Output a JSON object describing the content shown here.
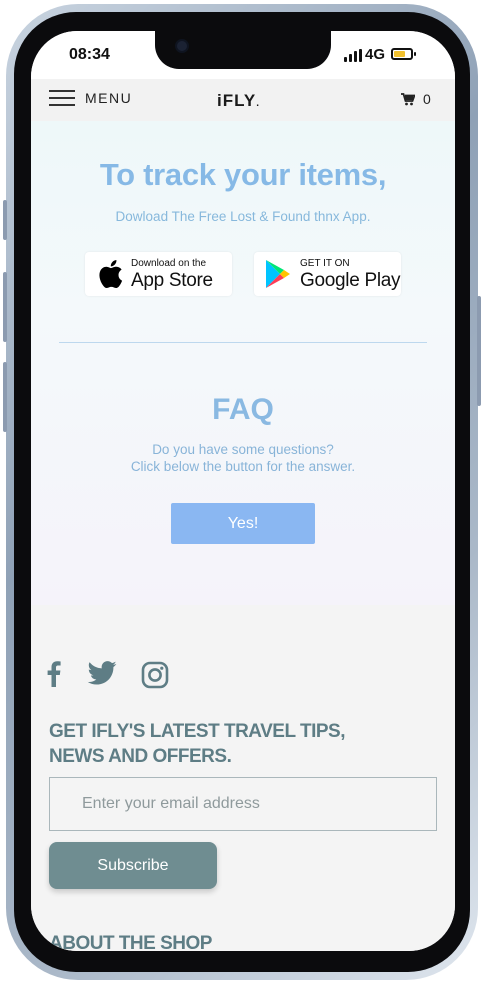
{
  "status_bar": {
    "time": "08:34",
    "network": "4G",
    "battery_color": "#f2c12e"
  },
  "nav": {
    "menu_label": "MENU",
    "logo": "iFLY",
    "cart_count": "0",
    "menu_icon": "hamburger-icon",
    "cart_icon": "cart-icon"
  },
  "promo": {
    "headline": "To track your items,",
    "subtitle": "Dowload The Free Lost & Found thnx App.",
    "app_store": {
      "small": "Download on the",
      "big": "App Store",
      "icon": "apple-icon"
    },
    "google_play": {
      "small": "GET IT ON",
      "big": "Google Play",
      "icon": "google-play-icon"
    }
  },
  "faq": {
    "title": "FAQ",
    "line1": "Do you have some questions?",
    "line2": "Click below the button for the answer.",
    "button": "Yes!"
  },
  "footer": {
    "social": [
      "facebook-icon",
      "twitter-icon",
      "instagram-icon"
    ],
    "heading": "GET IFLY'S LATEST TRAVEL TIPS, NEWS AND OFFERS.",
    "email_placeholder": "Enter your email address",
    "email_value": "",
    "subscribe_label": "Subscribe",
    "about_heading": "ABOUT THE SHOP"
  },
  "colors": {
    "accent_blue": "#86b9e6",
    "button_blue": "#8ab7f2",
    "footer_teal": "#5e7d85",
    "subscribe_bg": "#6f8d91"
  }
}
